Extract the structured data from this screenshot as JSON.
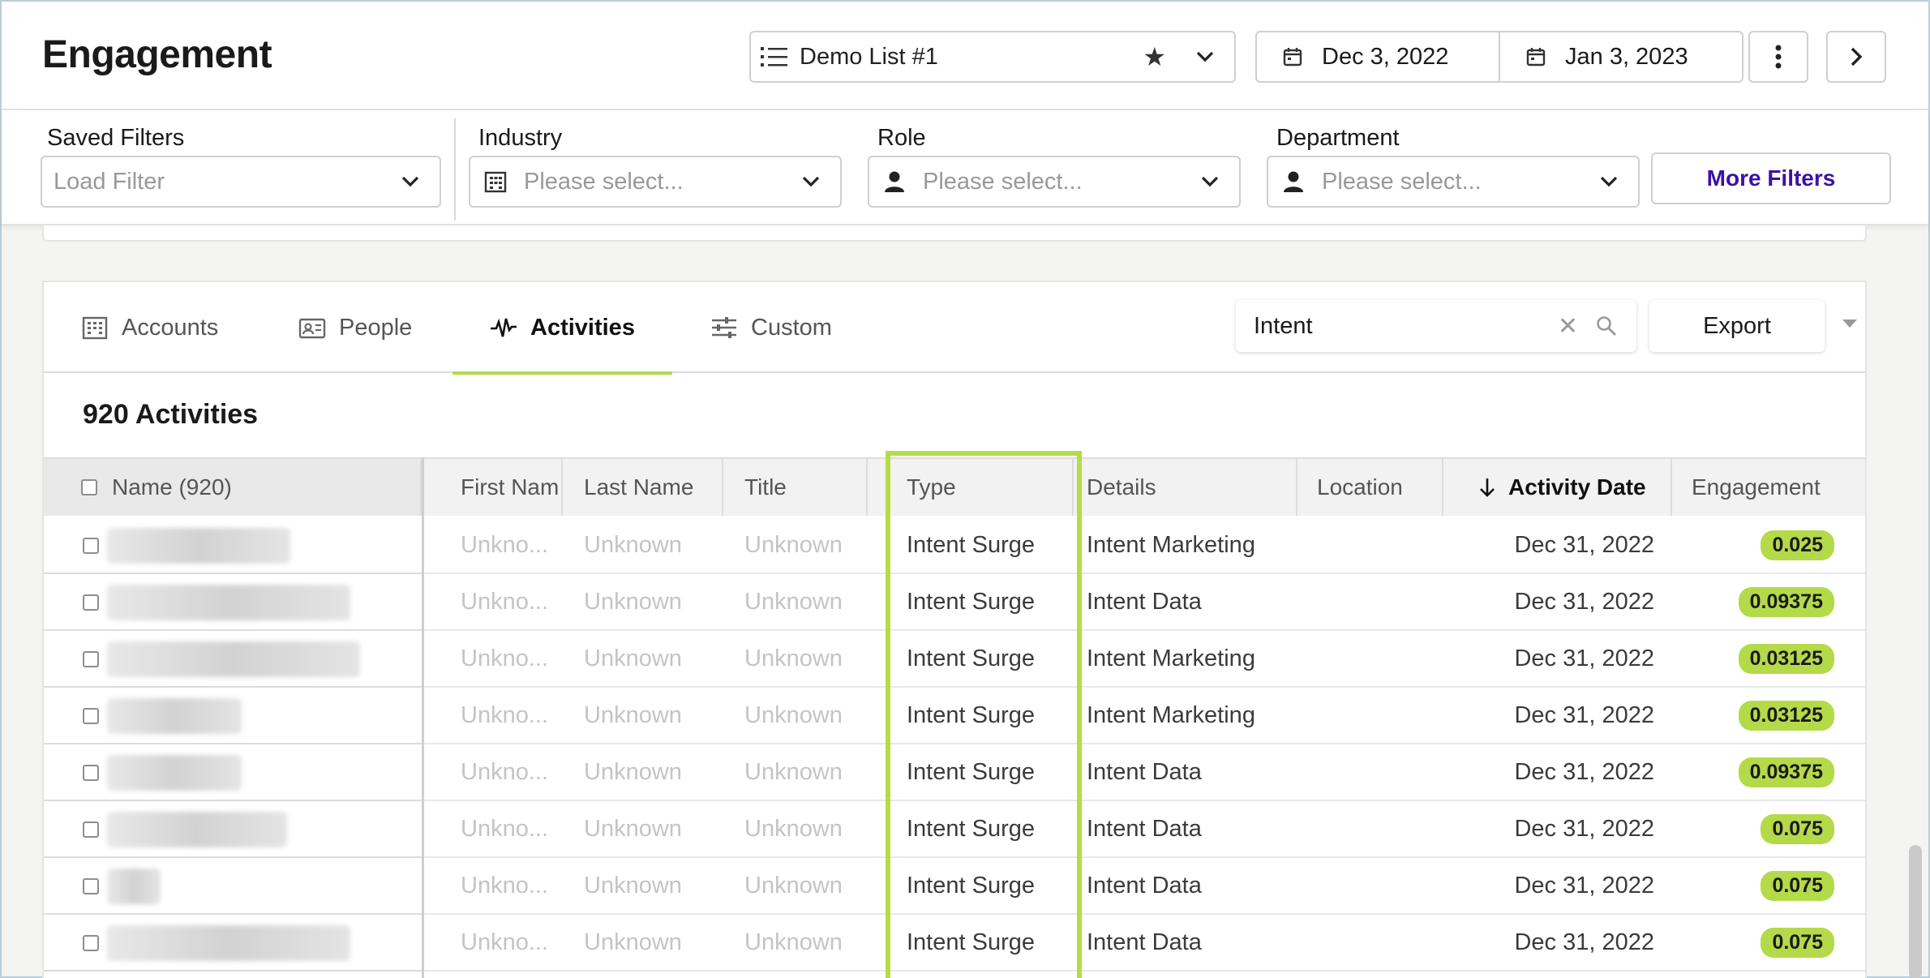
{
  "header": {
    "title": "Engagement",
    "list_select": "Demo List #1",
    "date_start": "Dec 3, 2022",
    "date_end": "Jan 3, 2023"
  },
  "filters": {
    "saved": {
      "label": "Saved Filters",
      "placeholder": "Load Filter"
    },
    "industry": {
      "label": "Industry",
      "placeholder": "Please select..."
    },
    "role": {
      "label": "Role",
      "placeholder": "Please select..."
    },
    "department": {
      "label": "Department",
      "placeholder": "Please select..."
    },
    "more_label": "More Filters"
  },
  "tabs": [
    {
      "label": "Accounts",
      "icon": "building-icon"
    },
    {
      "label": "People",
      "icon": "contact-card-icon"
    },
    {
      "label": "Activities",
      "icon": "pulse-icon"
    },
    {
      "label": "Custom",
      "icon": "sliders-icon"
    }
  ],
  "search": {
    "value": "Intent"
  },
  "export_label": "Export",
  "count_label": "920 Activities",
  "table": {
    "columns": [
      "Name (920)",
      "First Nam",
      "Last Name",
      "Title",
      "Type",
      "Details",
      "Location",
      "Activity Date",
      "Engagement"
    ],
    "rows": [
      {
        "first": "Unkno...",
        "last": "Unknown",
        "title": "Unknown",
        "type": "Intent Surge",
        "details": "Intent Marketing",
        "location": "",
        "date": "Dec 31, 2022",
        "engagement": "0.025"
      },
      {
        "first": "Unkno...",
        "last": "Unknown",
        "title": "Unknown",
        "type": "Intent Surge",
        "details": "Intent Data",
        "location": "",
        "date": "Dec 31, 2022",
        "engagement": "0.09375"
      },
      {
        "first": "Unkno...",
        "last": "Unknown",
        "title": "Unknown",
        "type": "Intent Surge",
        "details": "Intent Marketing",
        "location": "",
        "date": "Dec 31, 2022",
        "engagement": "0.03125"
      },
      {
        "first": "Unkno...",
        "last": "Unknown",
        "title": "Unknown",
        "type": "Intent Surge",
        "details": "Intent Marketing",
        "location": "",
        "date": "Dec 31, 2022",
        "engagement": "0.03125"
      },
      {
        "first": "Unkno...",
        "last": "Unknown",
        "title": "Unknown",
        "type": "Intent Surge",
        "details": "Intent Data",
        "location": "",
        "date": "Dec 31, 2022",
        "engagement": "0.09375"
      },
      {
        "first": "Unkno...",
        "last": "Unknown",
        "title": "Unknown",
        "type": "Intent Surge",
        "details": "Intent Data",
        "location": "",
        "date": "Dec 31, 2022",
        "engagement": "0.075"
      },
      {
        "first": "Unkno...",
        "last": "Unknown",
        "title": "Unknown",
        "type": "Intent Surge",
        "details": "Intent Data",
        "location": "",
        "date": "Dec 31, 2022",
        "engagement": "0.075"
      },
      {
        "first": "Unkno...",
        "last": "Unknown",
        "title": "Unknown",
        "type": "Intent Surge",
        "details": "Intent Data",
        "location": "",
        "date": "Dec 31, 2022",
        "engagement": "0.075"
      }
    ]
  },
  "colors": {
    "accent": "#b4da49",
    "link": "#3a12a6"
  }
}
